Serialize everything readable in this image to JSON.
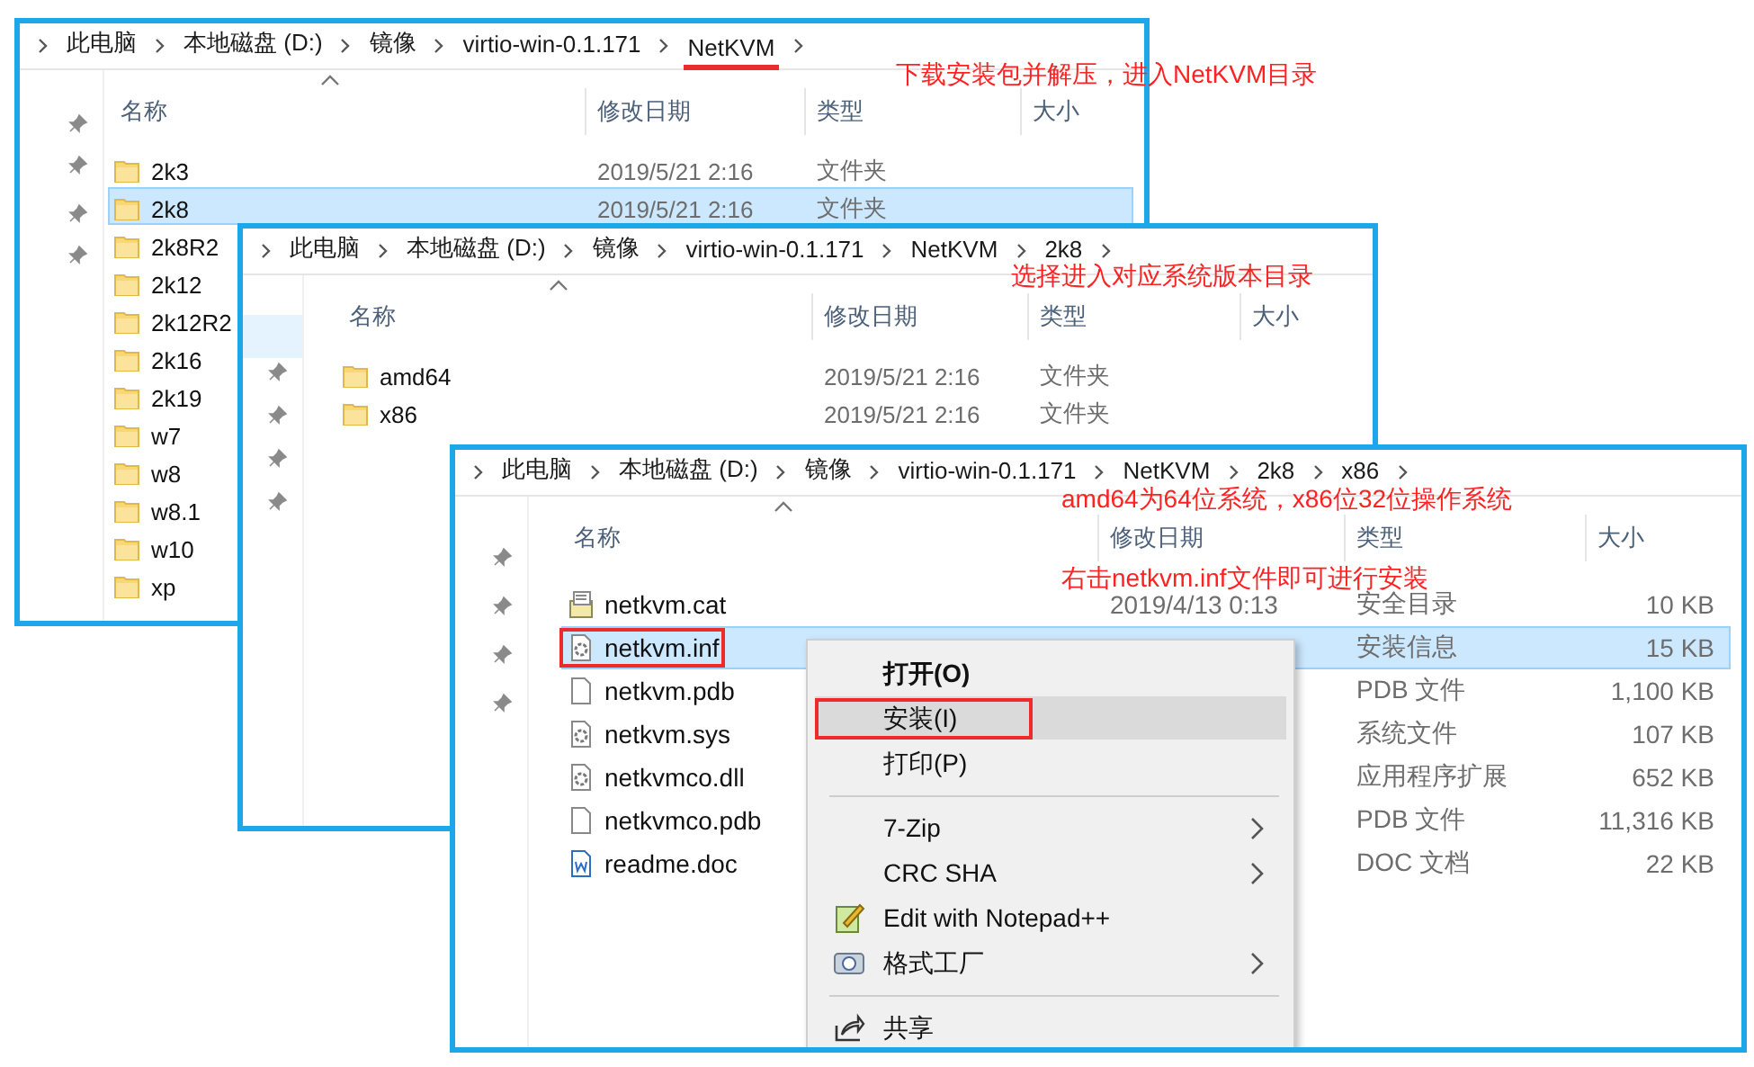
{
  "windows": [
    {
      "breadcrumb": [
        {
          "label": "此电脑",
          "underlined": false
        },
        {
          "label": "本地磁盘 (D:)",
          "underlined": false
        },
        {
          "label": "镜像",
          "underlined": false
        },
        {
          "label": "virtio-win-0.1.171",
          "underlined": false
        },
        {
          "label": "NetKVM",
          "underlined": true
        }
      ],
      "columns": [
        "名称",
        "修改日期",
        "类型",
        "大小"
      ],
      "notes": [
        "下载安装包并解压，进入NetKVM目录"
      ],
      "rows": [
        {
          "name": "2k3",
          "kind": "folder",
          "date": "2019/5/21 2:16",
          "type": "文件夹",
          "selected": false,
          "highlighted": false
        },
        {
          "name": "2k8",
          "kind": "folder",
          "date": "2019/5/21 2:16",
          "type": "文件夹",
          "selected": true,
          "highlighted": false
        },
        {
          "name": "2k8R2",
          "kind": "folder",
          "selected": false,
          "highlighted": false
        },
        {
          "name": "2k12",
          "kind": "folder",
          "selected": false,
          "highlighted": false
        },
        {
          "name": "2k12R2",
          "kind": "folder",
          "selected": false,
          "highlighted": false
        },
        {
          "name": "2k16",
          "kind": "folder",
          "selected": false,
          "highlighted": false
        },
        {
          "name": "2k19",
          "kind": "folder",
          "selected": false,
          "highlighted": false
        },
        {
          "name": "w7",
          "kind": "folder",
          "selected": false,
          "highlighted": false
        },
        {
          "name": "w8",
          "kind": "folder",
          "selected": false,
          "highlighted": false
        },
        {
          "name": "w8.1",
          "kind": "folder",
          "selected": false,
          "highlighted": false
        },
        {
          "name": "w10",
          "kind": "folder",
          "selected": false,
          "highlighted": false
        },
        {
          "name": "xp",
          "kind": "folder",
          "selected": false,
          "highlighted": false
        }
      ]
    },
    {
      "breadcrumb": [
        {
          "label": "此电脑",
          "underlined": false
        },
        {
          "label": "本地磁盘 (D:)",
          "underlined": false
        },
        {
          "label": "镜像",
          "underlined": false
        },
        {
          "label": "virtio-win-0.1.171",
          "underlined": false
        },
        {
          "label": "NetKVM",
          "underlined": false
        },
        {
          "label": "2k8",
          "underlined": false
        }
      ],
      "columns": [
        "名称",
        "修改日期",
        "类型",
        "大小"
      ],
      "notes": [
        "选择进入对应系统版本目录"
      ],
      "rows": [
        {
          "name": "amd64",
          "kind": "folder",
          "date": "2019/5/21 2:16",
          "type": "文件夹",
          "selected": false,
          "highlighted": false
        },
        {
          "name": "x86",
          "kind": "folder",
          "date": "2019/5/21 2:16",
          "type": "文件夹",
          "selected": false,
          "highlighted": false
        }
      ]
    },
    {
      "breadcrumb": [
        {
          "label": "此电脑",
          "underlined": false
        },
        {
          "label": "本地磁盘 (D:)",
          "underlined": false
        },
        {
          "label": "镜像",
          "underlined": false
        },
        {
          "label": "virtio-win-0.1.171",
          "underlined": false
        },
        {
          "label": "NetKVM",
          "underlined": false
        },
        {
          "label": "2k8",
          "underlined": false
        },
        {
          "label": "x86",
          "underlined": false
        }
      ],
      "columns": [
        "名称",
        "修改日期",
        "类型",
        "大小"
      ],
      "notes": [
        "amd64为64位系统，x86位32位操作系统",
        "右击netkvm.inf文件即可进行安装"
      ],
      "rows": [
        {
          "name": "netkvm.cat",
          "kind": "catalog",
          "date": "2019/4/13 0:13",
          "type": "安全目录",
          "size": "10 KB",
          "selected": false,
          "highlighted": false
        },
        {
          "name": "netkvm.inf",
          "kind": "settings",
          "type": "安装信息",
          "size": "15 KB",
          "selected": true,
          "highlighted": true
        },
        {
          "name": "netkvm.pdb",
          "kind": "blank",
          "type": "PDB 文件",
          "size": "1,100 KB",
          "selected": false,
          "highlighted": false
        },
        {
          "name": "netkvm.sys",
          "kind": "settings",
          "type": "系统文件",
          "size": "107 KB",
          "selected": false,
          "highlighted": false
        },
        {
          "name": "netkvmco.dll",
          "kind": "settings",
          "type": "应用程序扩展",
          "size": "652 KB",
          "selected": false,
          "highlighted": false
        },
        {
          "name": "netkvmco.pdb",
          "kind": "blank",
          "type": "PDB 文件",
          "size": "11,316 KB",
          "selected": false,
          "highlighted": false
        },
        {
          "name": "readme.doc",
          "kind": "word",
          "type": "DOC 文档",
          "size": "22 KB",
          "selected": false,
          "highlighted": false
        }
      ],
      "context_menu": [
        {
          "label": "打开(O)",
          "kind": "plain",
          "bold": true,
          "hovered": false,
          "highlighted": false,
          "submenu": false,
          "separator_before": false
        },
        {
          "label": "安装(I)",
          "kind": "plain",
          "bold": false,
          "hovered": true,
          "highlighted": true,
          "submenu": false,
          "separator_before": false
        },
        {
          "label": "打印(P)",
          "kind": "plain",
          "bold": false,
          "hovered": false,
          "highlighted": false,
          "submenu": false,
          "separator_before": false
        },
        {
          "label": "7-Zip",
          "kind": "plain",
          "bold": false,
          "hovered": false,
          "highlighted": false,
          "submenu": true,
          "separator_before": true
        },
        {
          "label": "CRC SHA",
          "kind": "plain",
          "bold": false,
          "hovered": false,
          "highlighted": false,
          "submenu": true,
          "separator_before": false
        },
        {
          "label": "Edit with Notepad++",
          "kind": "notepad",
          "bold": false,
          "hovered": false,
          "highlighted": false,
          "submenu": false,
          "separator_before": false
        },
        {
          "label": "格式工厂",
          "kind": "factory",
          "bold": false,
          "hovered": false,
          "highlighted": false,
          "submenu": true,
          "separator_before": false
        },
        {
          "label": "共享",
          "kind": "share",
          "bold": false,
          "hovered": false,
          "highlighted": false,
          "submenu": false,
          "separator_before": true
        }
      ]
    }
  ]
}
